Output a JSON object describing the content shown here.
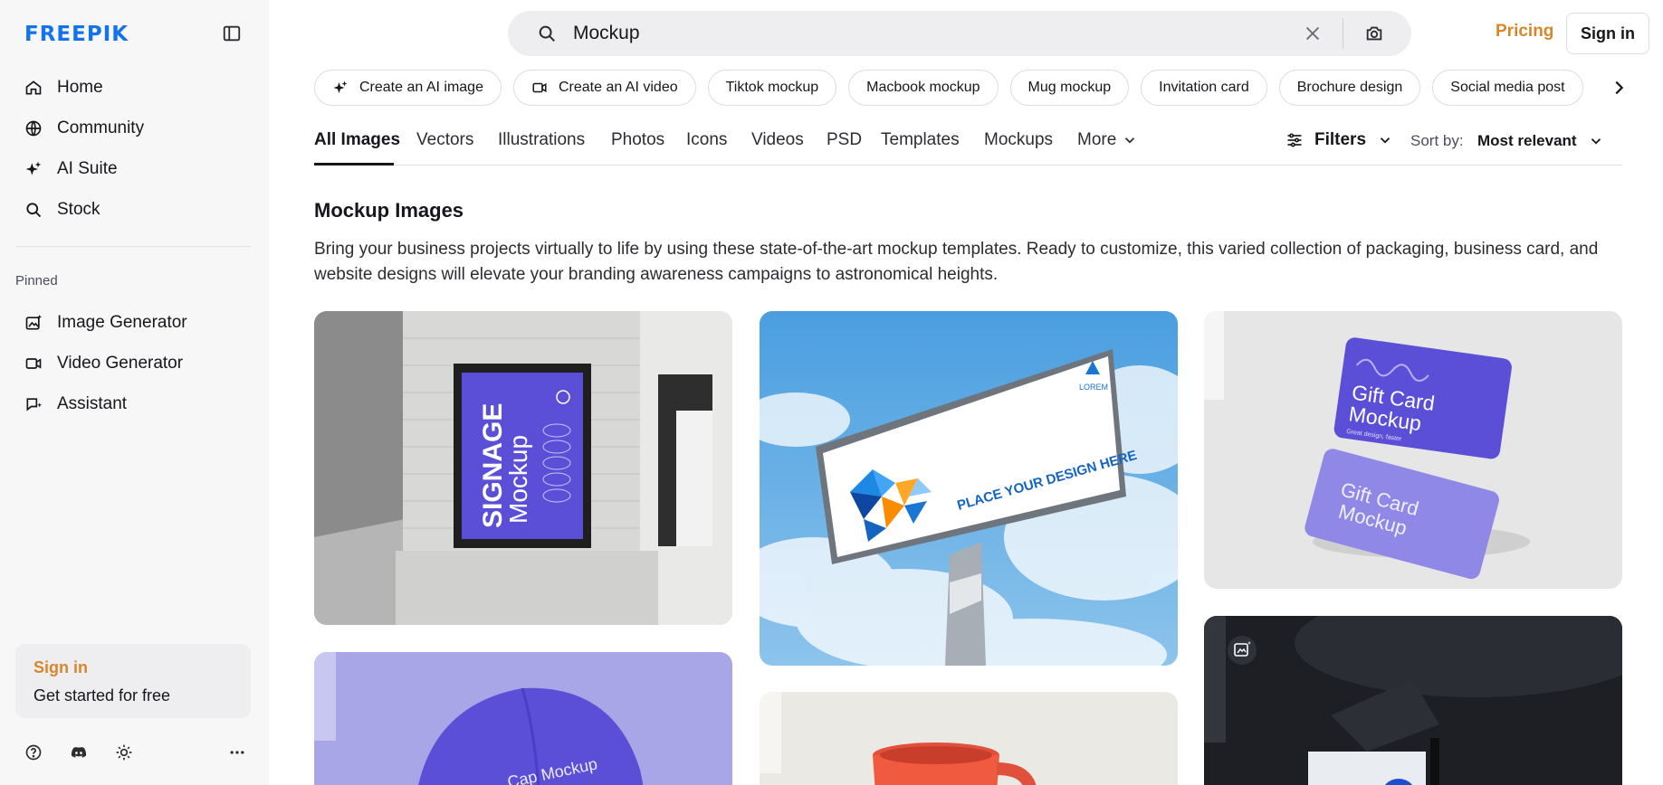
{
  "brand": {
    "logo": "FREEPIK"
  },
  "sidebar": {
    "nav": [
      {
        "label": "Home",
        "icon": "home-icon"
      },
      {
        "label": "Community",
        "icon": "globe-icon"
      },
      {
        "label": "AI Suite",
        "icon": "sparkle-icon"
      },
      {
        "label": "Stock",
        "icon": "search-icon"
      }
    ],
    "pinned_label": "Pinned",
    "pinned": [
      {
        "label": "Image Generator",
        "icon": "image-sparkle-icon"
      },
      {
        "label": "Video Generator",
        "icon": "video-icon"
      },
      {
        "label": "Assistant",
        "icon": "chat-sparkle-icon"
      }
    ],
    "signin_card": {
      "title": "Sign in",
      "subtitle": "Get started for free"
    }
  },
  "header": {
    "search_value": "Mockup",
    "pricing": "Pricing",
    "sign_in": "Sign in"
  },
  "chips": [
    {
      "label": "Create an AI image",
      "icon": "sparkle-icon"
    },
    {
      "label": "Create an AI video",
      "icon": "video-icon"
    },
    {
      "label": "Tiktok mockup"
    },
    {
      "label": "Macbook mockup"
    },
    {
      "label": "Mug mockup"
    },
    {
      "label": "Invitation card"
    },
    {
      "label": "Brochure design"
    },
    {
      "label": "Social media post"
    }
  ],
  "tabs": {
    "items": [
      "All Images",
      "Vectors",
      "Illustrations",
      "Photos",
      "Icons",
      "Videos",
      "PSD",
      "Templates",
      "Mockups",
      "More"
    ],
    "active": "All Images",
    "filters": "Filters",
    "sort_label": "Sort by:",
    "sort_value": "Most relevant"
  },
  "content": {
    "title": "Mockup Images",
    "description": "Bring your business projects virtually to life by using these state-of-the-art mockup templates. Ready to customize, this varied collection of packaging, business card, and website designs will elevate your branding awareness campaigns to astronomical heights."
  },
  "images": {
    "signage": {
      "line1": "SIGNAGE",
      "line2": "Mockup"
    },
    "billboard": {
      "brand": "LOREM",
      "tagline": "PLACE YOUR DESIGN HERE"
    },
    "giftcard": {
      "line1": "Gift Card",
      "line2": "Mockup",
      "small": "Great design, faster"
    },
    "cap": {
      "text": "Cap Mockup"
    }
  },
  "colors": {
    "brand_blue": "#1273eb",
    "accent_orange": "#d7862b",
    "mockup_purple": "#5b4fd8"
  }
}
